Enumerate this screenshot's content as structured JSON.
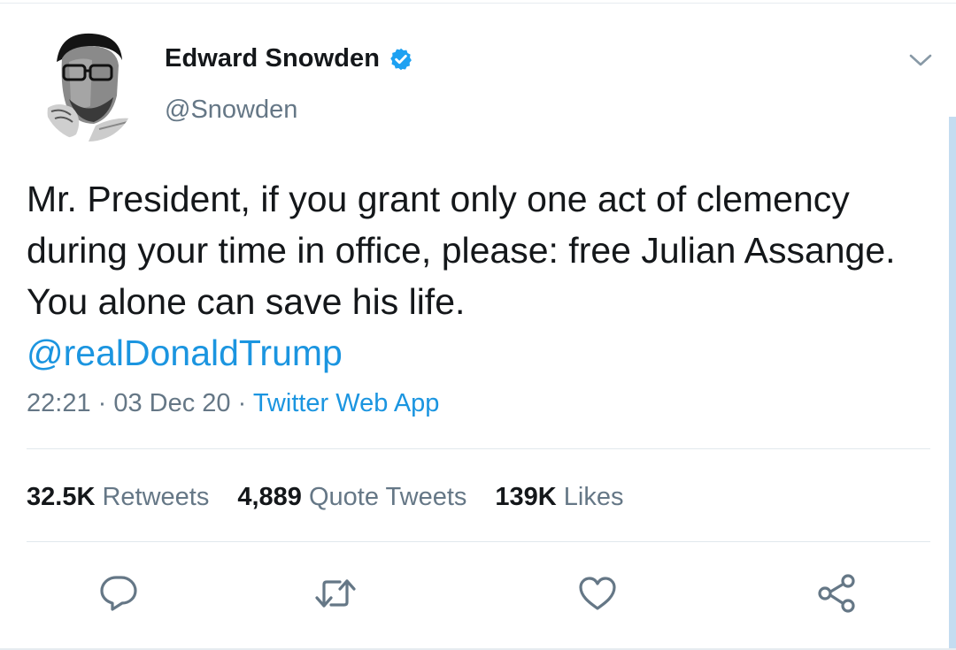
{
  "tweet": {
    "author": {
      "display_name": "Edward Snowden",
      "handle": "@Snowden",
      "verified": true,
      "avatar": "avatar-photo"
    },
    "text": "Mr. President, if you grant only one act of clemency during your time in office, please: free Julian Assange. You alone can save his life.",
    "mention": "@realDonaldTrump",
    "meta": {
      "time": "22:21",
      "separator": " · ",
      "date": "03 Dec 20",
      "source": "Twitter Web App"
    },
    "stats": [
      {
        "count": "32.5K",
        "label": "Retweets"
      },
      {
        "count": "4,889",
        "label": "Quote Tweets"
      },
      {
        "count": "139K",
        "label": "Likes"
      }
    ],
    "actions": [
      {
        "icon": "reply-icon"
      },
      {
        "icon": "retweet-icon"
      },
      {
        "icon": "like-icon"
      },
      {
        "icon": "share-icon"
      }
    ]
  },
  "colors": {
    "accent": "#1b95e0",
    "text_primary": "#14171a",
    "text_secondary": "#657786",
    "divider": "#e1e8ed",
    "verified_badge": "#1da1f2"
  }
}
